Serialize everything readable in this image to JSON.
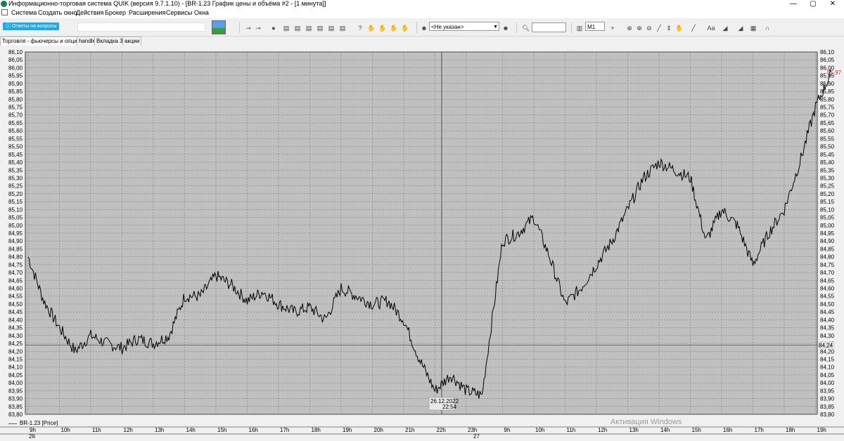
{
  "window": {
    "title": "Информационно-торговая система QUIK (версия 9.7.1.10) - [BR-1.23 График цены и объёма #2 - [1 минута]]",
    "buttons": {
      "minimize": "—",
      "maximize": "▢",
      "close": "✕"
    }
  },
  "menu": [
    "Система",
    "Создать окно",
    "Действия",
    "Брокер",
    "Расширения",
    "Сервисы",
    "Окна"
  ],
  "toolbar": {
    "answers_label": "Ответы на вопросы",
    "account_value": "<Не указан>",
    "interval_value": "M1",
    "icons": [
      "key-icon",
      "key-plus-icon",
      "order-icon",
      "table-icon",
      "table-icon",
      "table-icon",
      "table-icon",
      "table-icon",
      "table-icon",
      "info-icon",
      "hand-icon",
      "hand-icon",
      "hand-icon",
      "hand-icon",
      "user-icon",
      "search-icon",
      "chart-icon",
      "cross-icon",
      "zoom-in-icon",
      "zoom-out-icon",
      "ruler-icon",
      "scale-icon",
      "hand-icon",
      "line-icon",
      "text-icon",
      "fill-icon",
      "template-icon",
      "magnet-icon"
    ],
    "text_tool_label": "Aa"
  },
  "tabs": [
    {
      "label": "Торговля - фьючерсы и опционы",
      "active": true
    },
    {
      "label": "handle",
      "active": false
    },
    {
      "label": "Вкладка 3",
      "active": false
    },
    {
      "label": "акции",
      "active": false
    }
  ],
  "chart": {
    "legend": "BR-1.23 [Price]",
    "current_price": "85,97",
    "marker_price": "84,24",
    "cursor_date": "26.12.2022",
    "cursor_time": "22:54",
    "watermark": "Активация Windows",
    "colors": {
      "background": "#c0c0c0",
      "line": "#000000",
      "grid": "#707070",
      "price_label": "#d03030"
    }
  },
  "chart_data": {
    "type": "line",
    "title": "",
    "xlabel": "",
    "ylabel": "",
    "ylim": [
      83.8,
      86.1
    ],
    "y_ticks": [
      "86,10",
      "86,05",
      "86,00",
      "85,95",
      "85,90",
      "85,85",
      "85,80",
      "85,75",
      "85,70",
      "85,65",
      "85,60",
      "85,55",
      "85,50",
      "85,45",
      "85,40",
      "85,35",
      "85,30",
      "85,25",
      "85,20",
      "85,15",
      "85,10",
      "85,05",
      "85,00",
      "84,95",
      "84,90",
      "84,85",
      "84,80",
      "84,75",
      "84,70",
      "84,65",
      "84,60",
      "84,55",
      "84,50",
      "84,45",
      "84,40",
      "84,35",
      "84,30",
      "84,25",
      "84,20",
      "84,15",
      "84,10",
      "84,05",
      "84,00",
      "83,95",
      "83,90",
      "83,85",
      "83,80"
    ],
    "x_ticks": [
      "9h",
      "10h",
      "11h",
      "12h",
      "13h",
      "14h",
      "15h",
      "16h",
      "17h",
      "18h",
      "19h",
      "20h",
      "21h",
      "22h",
      "23h",
      "9h",
      "10h",
      "11h",
      "12h",
      "13h",
      "14h",
      "15h",
      "16h",
      "17h",
      "18h",
      "19h"
    ],
    "dates": [
      "26",
      "27"
    ],
    "grid": true,
    "series": [
      {
        "name": "BR-1.23 [Price]",
        "x": [
          "26 09:00",
          "26 09:30",
          "26 10:00",
          "26 10:30",
          "26 11:00",
          "26 11:30",
          "26 12:00",
          "26 12:30",
          "26 13:00",
          "26 13:30",
          "26 14:00",
          "26 14:30",
          "26 15:00",
          "26 15:30",
          "26 16:00",
          "26 16:30",
          "26 17:00",
          "26 17:30",
          "26 18:00",
          "26 18:30",
          "26 19:00",
          "26 19:30",
          "26 20:00",
          "26 20:30",
          "26 21:00",
          "26 21:30",
          "26 22:00",
          "26 22:30",
          "26 23:00",
          "26 23:30",
          "27 09:00",
          "27 09:30",
          "27 10:00",
          "27 10:30",
          "27 11:00",
          "27 11:30",
          "27 12:00",
          "27 12:30",
          "27 13:00",
          "27 13:30",
          "27 14:00",
          "27 14:30",
          "27 15:00",
          "27 15:30",
          "27 16:00",
          "27 16:30",
          "27 17:00",
          "27 17:30",
          "27 18:00",
          "27 18:30",
          "27 19:00",
          "27 19:30"
        ],
        "values": [
          84.8,
          84.52,
          84.35,
          84.2,
          84.3,
          84.25,
          84.22,
          84.28,
          84.25,
          84.3,
          84.55,
          84.55,
          84.68,
          84.62,
          84.52,
          84.58,
          84.5,
          84.45,
          84.48,
          84.4,
          84.6,
          84.55,
          84.5,
          84.52,
          84.4,
          84.15,
          83.95,
          84.05,
          83.95,
          83.92,
          84.9,
          84.95,
          85.05,
          84.8,
          84.5,
          84.6,
          84.75,
          84.9,
          85.1,
          85.3,
          85.4,
          85.35,
          85.3,
          84.9,
          85.1,
          85.0,
          84.75,
          84.95,
          85.1,
          85.4,
          85.75,
          85.97
        ]
      }
    ]
  }
}
